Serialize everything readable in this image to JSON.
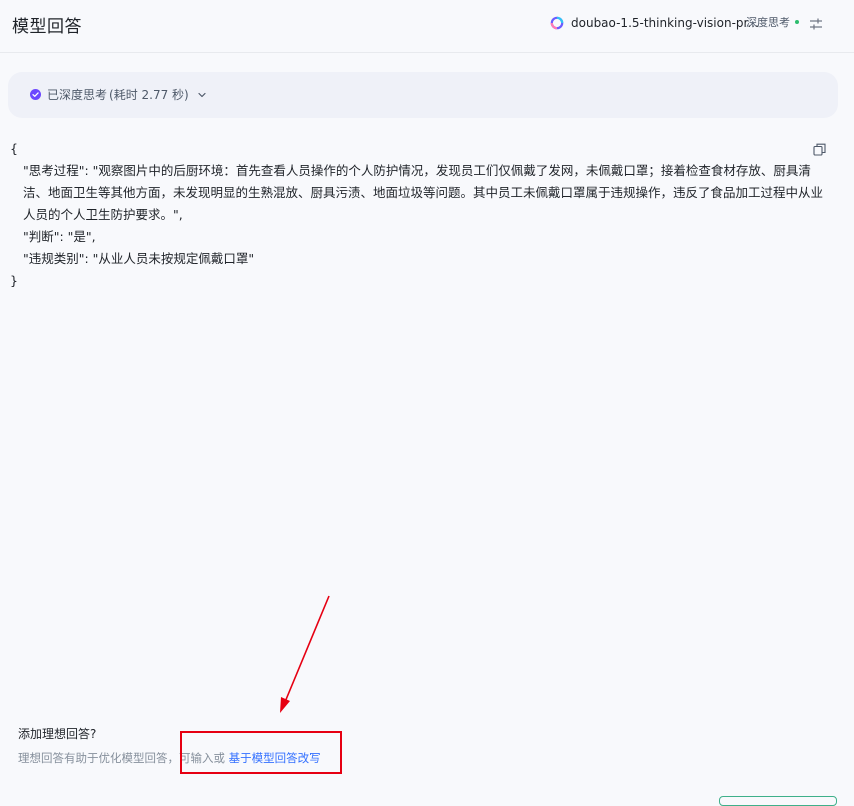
{
  "header": {
    "title": "模型回答",
    "model_name": "doubao-1.5-thinking-vision-pr...",
    "deep_think_label": "深度思考",
    "status_color": "#2ebd6e"
  },
  "thinking": {
    "label": "已深度思考",
    "time_text": "(耗时 2.77 秒)"
  },
  "response": {
    "lines": [
      "{",
      "\"思考过程\": \"观察图片中的后厨环境：首先查看人员操作的个人防护情况，发现员工们仅佩戴了发网，未佩戴口罩；接着检查食材存放、厨具清洁、地面卫生等其他方面，未发现明显的生熟混放、厨具污渍、地面垃圾等问题。其中员工未佩戴口罩属于违规操作，违反了食品加工过程中从业人员的个人卫生防护要求。\",",
      "\"判断\": \"是\",",
      "\"违规类别\": \"从业人员未按规定佩戴口罩\"",
      "}"
    ]
  },
  "ideal": {
    "title": "添加理想回答?",
    "desc": "理想回答有助于优化模型回答，可输入或 ",
    "link": "基于模型回答改写"
  },
  "colors": {
    "accent": "#3370ff",
    "annotation": "#e60012",
    "check": "#6c47ff"
  },
  "icons": {
    "model_logo": "doubao-logo-icon",
    "settings": "sliders-icon",
    "check": "check-circle-icon",
    "chevron": "chevron-down-icon",
    "copy": "copy-icon"
  }
}
